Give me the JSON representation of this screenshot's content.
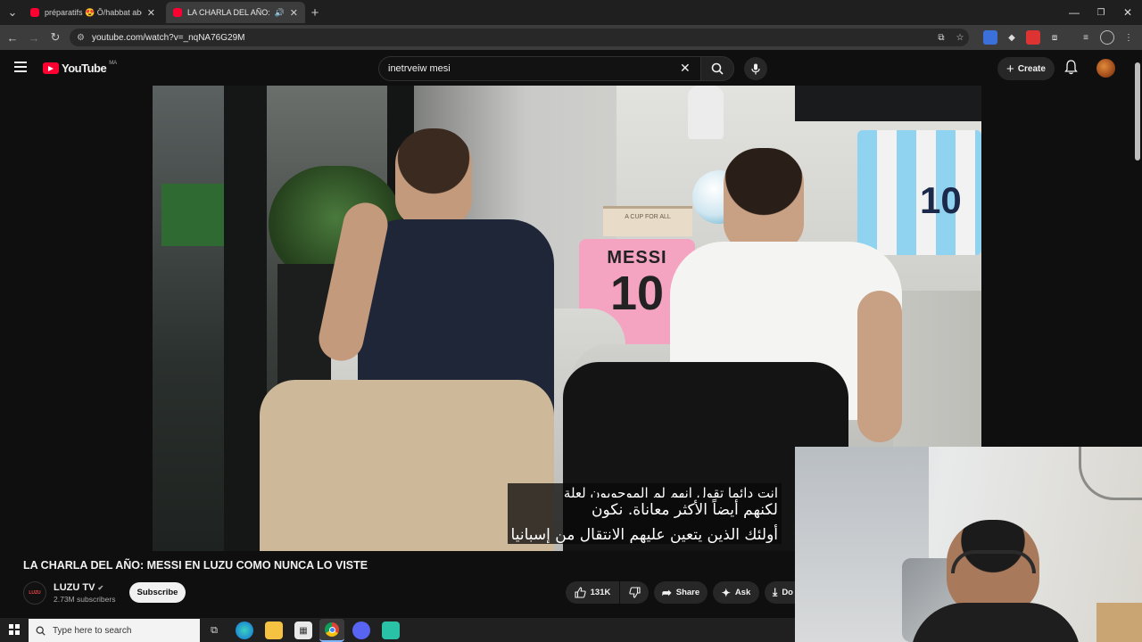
{
  "browser": {
    "tabs": [
      {
        "label": "préparatifs 😍 Ô/habbat abdel",
        "active": false
      },
      {
        "label": "LA CHARLA DEL AÑO: MESS",
        "active": true
      }
    ],
    "url": "youtube.com/watch?v=_nqNA76G29M"
  },
  "youtube": {
    "logo_text": "YouTube",
    "region": "MA",
    "search_value": "inetrveiw mesi",
    "create_label": "Create"
  },
  "video": {
    "shirt_text": "MESSI",
    "shirt_number": "10",
    "book_text": "A CUP FOR ALL",
    "subtitle_lines": [
      "انت دائما تقول إنهم لم الموجوبون لعلة",
      "لكنهم أيضاً الأكثر معاناة. نكون",
      "أولئك الذين يتعين عليهم الانتقال من إسبانيا"
    ],
    "title": "LA CHARLA DEL AÑO: MESSI EN LUZU COMO NUNCA LO VISTE",
    "channel": {
      "name": "LUZU TV",
      "subscribers": "2.73M subscribers",
      "avatar_text": "LUZU"
    },
    "subscribe_label": "Subscribe",
    "likes": "131K",
    "share_label": "Share",
    "ask_label": "Ask",
    "download_label": "Do"
  },
  "taskbar": {
    "search_placeholder": "Type here to search"
  },
  "colors": {
    "yt_red": "#ff0033",
    "background": "#0f0f0f"
  }
}
